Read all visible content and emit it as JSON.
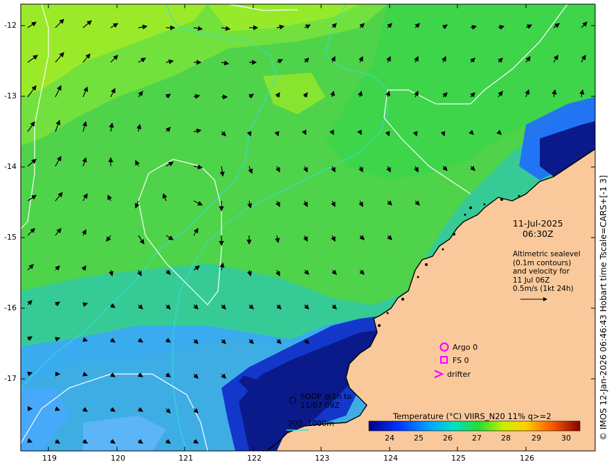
{
  "map": {
    "x_axis_ticks": [
      "119",
      "120",
      "121",
      "122",
      "123",
      "124",
      "125",
      "126"
    ],
    "y_axis_ticks": [
      "-12",
      "-13",
      "-14",
      "-15",
      "-16",
      "-17"
    ],
    "date_line1": "11-Jul-2025",
    "date_line2": "06:30Z",
    "altimetry_note": [
      "Altimetric sealevel",
      "(0.1m contours)",
      "and velocity for",
      "11 Jul 06Z",
      "0.5m/s (1kt 24h)"
    ],
    "legend": {
      "argo": "Argo 0",
      "fs": "FS 0",
      "drifter": "drifter",
      "soop_line1": "SOOP @1h to",
      "soop_line2": "11/07 09Z",
      "bathy_label": "200  1000m"
    },
    "colorbar": {
      "title": "Temperature (°C) VIIRS_N20 11% q>=2",
      "ticks": [
        "24",
        "25",
        "26",
        "27",
        "28",
        "29",
        "30"
      ],
      "range": [
        23.5,
        31
      ]
    },
    "credit": "© IMOS 12-Jan-2026 06:46:43 Hobart time Tscale=CARS+[-1 3]",
    "colors": {
      "land": "#f9c99b",
      "sst_warm": "#7fe84d",
      "sst_mid": "#2fd23b",
      "sst_cool": "#3aa0ff",
      "sst_cold": "#0a1a8a",
      "argo_marker": "#ff00ff",
      "bathymetry": "#33dddd"
    }
  }
}
